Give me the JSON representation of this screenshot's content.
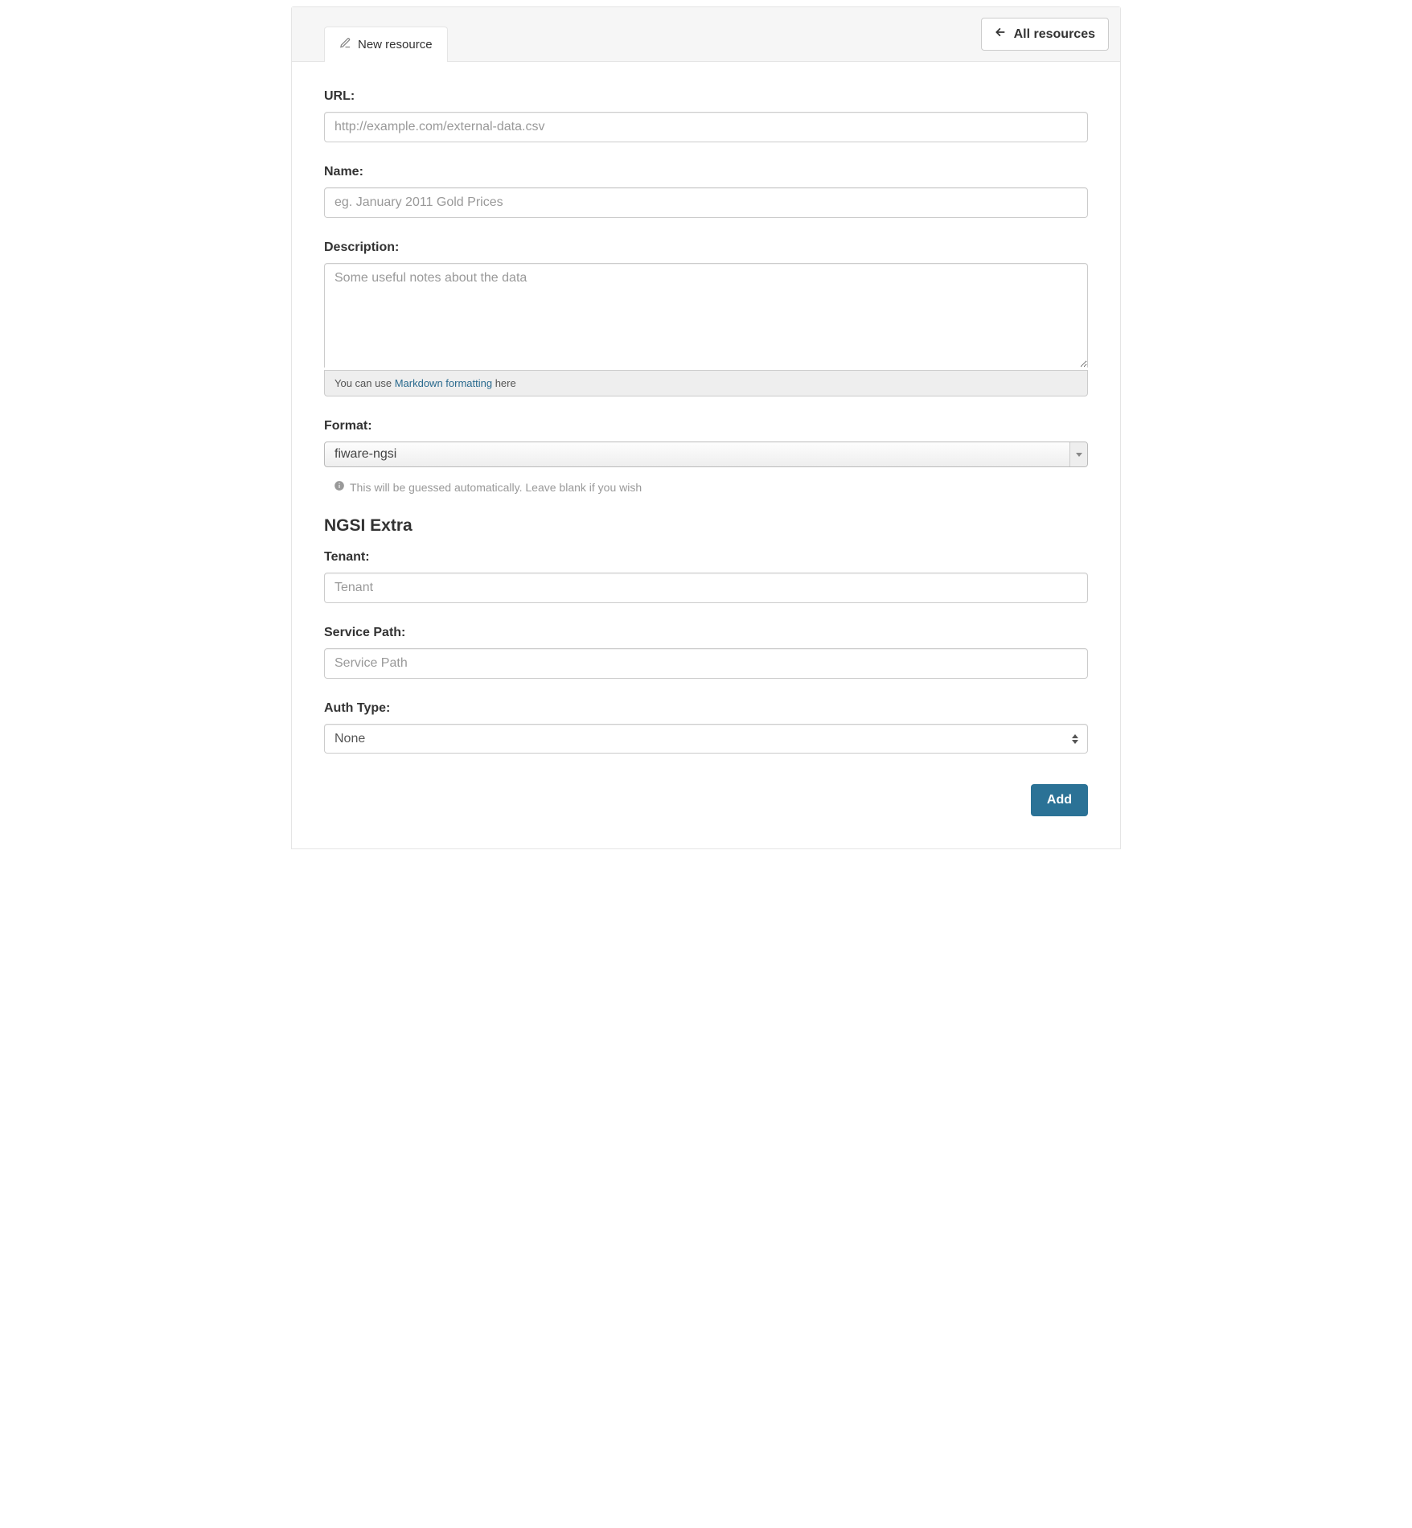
{
  "header": {
    "tab_label": "New resource",
    "all_resources_label": "All resources"
  },
  "form": {
    "url": {
      "label": "URL:",
      "placeholder": "http://example.com/external-data.csv",
      "value": ""
    },
    "name": {
      "label": "Name:",
      "placeholder": "eg. January 2011 Gold Prices",
      "value": ""
    },
    "description": {
      "label": "Description:",
      "placeholder": "Some useful notes about the data",
      "value": "",
      "hint_prefix": "You can use ",
      "hint_link": "Markdown formatting",
      "hint_suffix": " here"
    },
    "format": {
      "label": "Format:",
      "value": "fiware-ngsi",
      "helper": "This will be guessed automatically. Leave blank if you wish"
    }
  },
  "ngsi": {
    "heading": "NGSI Extra",
    "tenant": {
      "label": "Tenant:",
      "placeholder": "Tenant",
      "value": ""
    },
    "service_path": {
      "label": "Service Path:",
      "placeholder": "Service Path",
      "value": ""
    },
    "auth_type": {
      "label": "Auth Type:",
      "value": "None"
    }
  },
  "actions": {
    "add_label": "Add"
  }
}
